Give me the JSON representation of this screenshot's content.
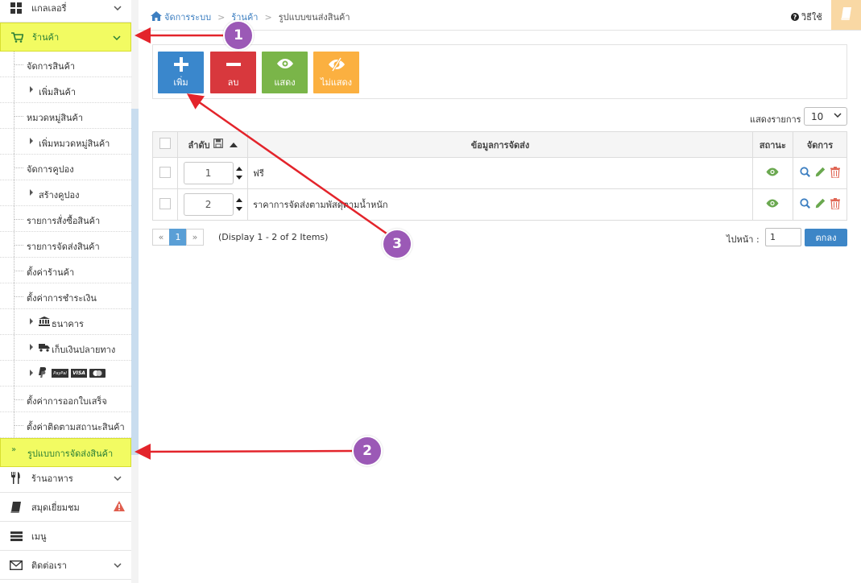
{
  "sidebar": {
    "items": [
      {
        "label": "แกลเลอรี่",
        "icon": "grid-icon"
      },
      {
        "label": "ร้านค้า",
        "icon": "cart-icon"
      },
      {
        "label": "ร้านอาหาร",
        "icon": "utensils-icon"
      },
      {
        "label": "สมุดเยี่ยมชม",
        "icon": "book-icon"
      },
      {
        "label": "เมนู",
        "icon": "menu-bars-icon"
      },
      {
        "label": "ติดต่อเรา",
        "icon": "envelope-icon"
      }
    ],
    "sub_items": [
      {
        "label": "จัดการสินค้า"
      },
      {
        "label": "เพิ่มสินค้า"
      },
      {
        "label": "หมวดหมู่สินค้า"
      },
      {
        "label": "เพิ่มหมวดหมู่สินค้า"
      },
      {
        "label": "จัดการคูปอง"
      },
      {
        "label": "สร้างคูปอง"
      },
      {
        "label": "รายการสั่งซื้อสินค้า"
      },
      {
        "label": "รายการจัดส่งสินค้า"
      },
      {
        "label": "ตั้งค่าร้านค้า"
      },
      {
        "label": "ตั้งค่าการชำระเงิน"
      },
      {
        "label": "ธนาคาร"
      },
      {
        "label": "เก็บเงินปลายทาง"
      },
      {
        "label": "ตั้งค่าการออกใบเสร็จ"
      },
      {
        "label": "ตั้งค่าติดตามสถานะสินค้า"
      },
      {
        "label": "รูปแบบการจัดส่งสินค้า"
      }
    ],
    "payment_logos": [
      "PayPal",
      "VISA"
    ]
  },
  "breadcrumb": {
    "home": "จัดการระบบ",
    "section": "ร้านค้า",
    "current": "รูปแบบขนส่งสินค้า"
  },
  "header": {
    "help_label": "วิธีใช้"
  },
  "toolbar": {
    "add_label": "เพิ่ม",
    "delete_label": "ลบ",
    "show_label": "แสดง",
    "hide_label": "ไม่แสดง"
  },
  "page_size": {
    "label": "แสดงรายการ",
    "value": "10"
  },
  "table": {
    "columns": {
      "order": "ลำดับ",
      "info": "ข้อมูลการจัดส่ง",
      "status": "สถานะ",
      "actions": "จัดการ"
    },
    "rows": [
      {
        "order": "1",
        "info": "ฟรี"
      },
      {
        "order": "2",
        "info": "ราคาการจัดส่งตามพัสดุตามน้ำหนัก"
      }
    ]
  },
  "pagination": {
    "prev": "«",
    "current": "1",
    "next": "»",
    "display_info": "(Display 1 - 2 of 2 Items)",
    "goto_label": "ไปหน้า :",
    "goto_value": "1",
    "goto_button": "ตกลง"
  },
  "annotations": {
    "badge1": "1",
    "badge2": "2",
    "badge3": "3"
  },
  "colors": {
    "add": "#3a87cc",
    "delete": "#d8383d",
    "show": "#7ab549",
    "hide": "#fbb040",
    "highlight": "#f2fb62",
    "arrow": "#e3242b",
    "badge": "#9b59b6"
  }
}
